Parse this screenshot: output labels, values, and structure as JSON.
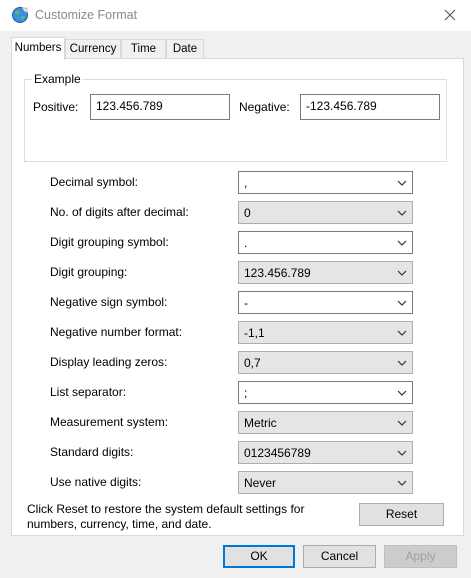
{
  "window": {
    "title": "Customize Format",
    "app_icon": "globe-icon"
  },
  "tabs": [
    {
      "label": "Numbers"
    },
    {
      "label": "Currency"
    },
    {
      "label": "Time"
    },
    {
      "label": "Date"
    }
  ],
  "example": {
    "legend": "Example",
    "positive_label": "Positive:",
    "positive_value": "123.456.789",
    "negative_label": "Negative:",
    "negative_value": "-123.456.789"
  },
  "settings": [
    {
      "label": "Decimal symbol:",
      "value": ","
    },
    {
      "label": "No. of digits after decimal:",
      "value": "0"
    },
    {
      "label": "Digit grouping symbol:",
      "value": "."
    },
    {
      "label": "Digit grouping:",
      "value": "123.456.789"
    },
    {
      "label": "Negative sign symbol:",
      "value": "-"
    },
    {
      "label": "Negative number format:",
      "value": "-1,1"
    },
    {
      "label": "Display leading zeros:",
      "value": "0,7"
    },
    {
      "label": "List separator:",
      "value": ";"
    },
    {
      "label": "Measurement system:",
      "value": "Metric"
    },
    {
      "label": "Standard digits:",
      "value": "0123456789"
    },
    {
      "label": "Use native digits:",
      "value": "Never"
    }
  ],
  "help_text": "Click Reset to restore the system default settings for numbers, currency, time, and date.",
  "buttons": {
    "reset": "Reset",
    "ok": "OK",
    "cancel": "Cancel",
    "apply": "Apply"
  }
}
